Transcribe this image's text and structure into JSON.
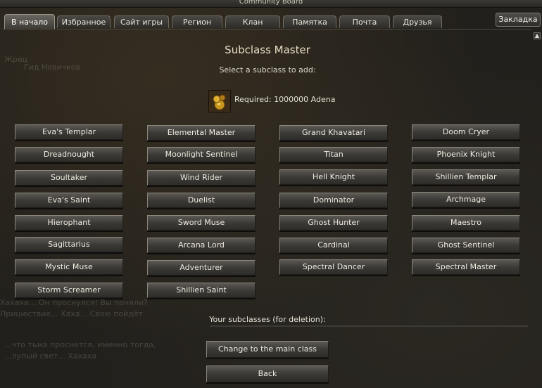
{
  "window": {
    "title": "Community Board"
  },
  "tabs": [
    {
      "label": "В начало",
      "active": true
    },
    {
      "label": "Избранное",
      "active": false
    },
    {
      "label": "Сайт игры",
      "active": false
    },
    {
      "label": "Регион",
      "active": false
    },
    {
      "label": "Клан",
      "active": false
    },
    {
      "label": "Памятка",
      "active": false
    },
    {
      "label": "Почта",
      "active": false
    },
    {
      "label": "Друзья",
      "active": false
    }
  ],
  "bookmark_label": "Закладка",
  "header": {
    "title": "Subclass Master",
    "subtitle": "Select a subclass to add:"
  },
  "cost": {
    "text": "Required: 1000000 Adena",
    "icon": "adena-icon"
  },
  "subclasses": [
    [
      "Eva's Templar",
      "Elemental Master",
      "Grand Khavatari",
      "Doom Cryer"
    ],
    [
      "Dreadnought",
      "Moonlight Sentinel",
      "Titan",
      "Phoenix Knight"
    ],
    [
      "Soultaker",
      "Wind Rider",
      "Hell Knight",
      "Shillien Templar"
    ],
    [
      "Eva's Saint",
      "Duelist",
      "Dominator",
      "Archmage"
    ],
    [
      "Hierophant",
      "Sword Muse",
      "Ghost Hunter",
      "Maestro"
    ],
    [
      "Sagittarius",
      "Arcana Lord",
      "Cardinal",
      "Ghost Sentinel"
    ],
    [
      "Mystic Muse",
      "Adventurer",
      "Spectral Dancer",
      "Spectral Master"
    ],
    [
      "Storm Screamer",
      "Shillien Saint"
    ]
  ],
  "deletion": {
    "label": "Your subclasses (for deletion):"
  },
  "actions": {
    "main_class": "Change to the main class",
    "back": "Back"
  },
  "background_text": {
    "line1": "Жрец",
    "line2": "Гид Новичков",
    "line3": "Хахаха... Он проснулся! Вы поняли?",
    "line4": "Пришествие... Хаха... Свою пойдёт",
    "line5": "...что тьма проснется, именно тогда,",
    "line6": "...лупый свет... Хахаха"
  },
  "colors": {
    "background": "#22201c",
    "button_top": "#5c5954",
    "button_bottom": "#2e2c29",
    "heading": "#e8dcc4"
  }
}
